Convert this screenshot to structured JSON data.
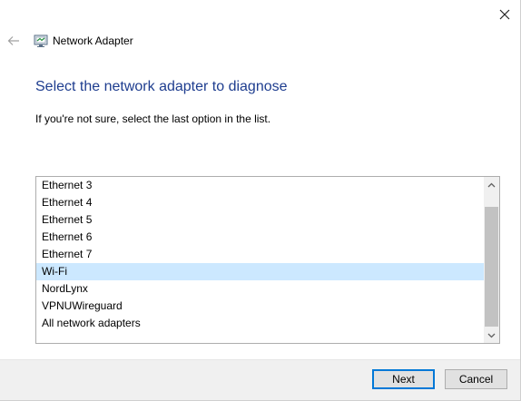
{
  "window": {
    "title": "Network Adapter",
    "app_icon": "network-adapter-icon",
    "back_icon": "back-arrow-icon",
    "close_icon": "close-icon"
  },
  "content": {
    "heading": "Select the network adapter to diagnose",
    "hint": "If you're not sure, select the last option in the list."
  },
  "adapters": {
    "items": [
      {
        "label": "Ethernet 3",
        "selected": false
      },
      {
        "label": "Ethernet 4",
        "selected": false
      },
      {
        "label": "Ethernet 5",
        "selected": false
      },
      {
        "label": "Ethernet 6",
        "selected": false
      },
      {
        "label": "Ethernet 7",
        "selected": false
      },
      {
        "label": "Wi-Fi",
        "selected": true
      },
      {
        "label": "NordLynx",
        "selected": false
      },
      {
        "label": "VPNUWireguard",
        "selected": false
      },
      {
        "label": "All network adapters",
        "selected": false
      }
    ],
    "selected_color": "#cce8ff"
  },
  "footer": {
    "next_label": "Next",
    "cancel_label": "Cancel"
  },
  "colors": {
    "heading": "#1e3d8f",
    "accent": "#0078d7"
  }
}
